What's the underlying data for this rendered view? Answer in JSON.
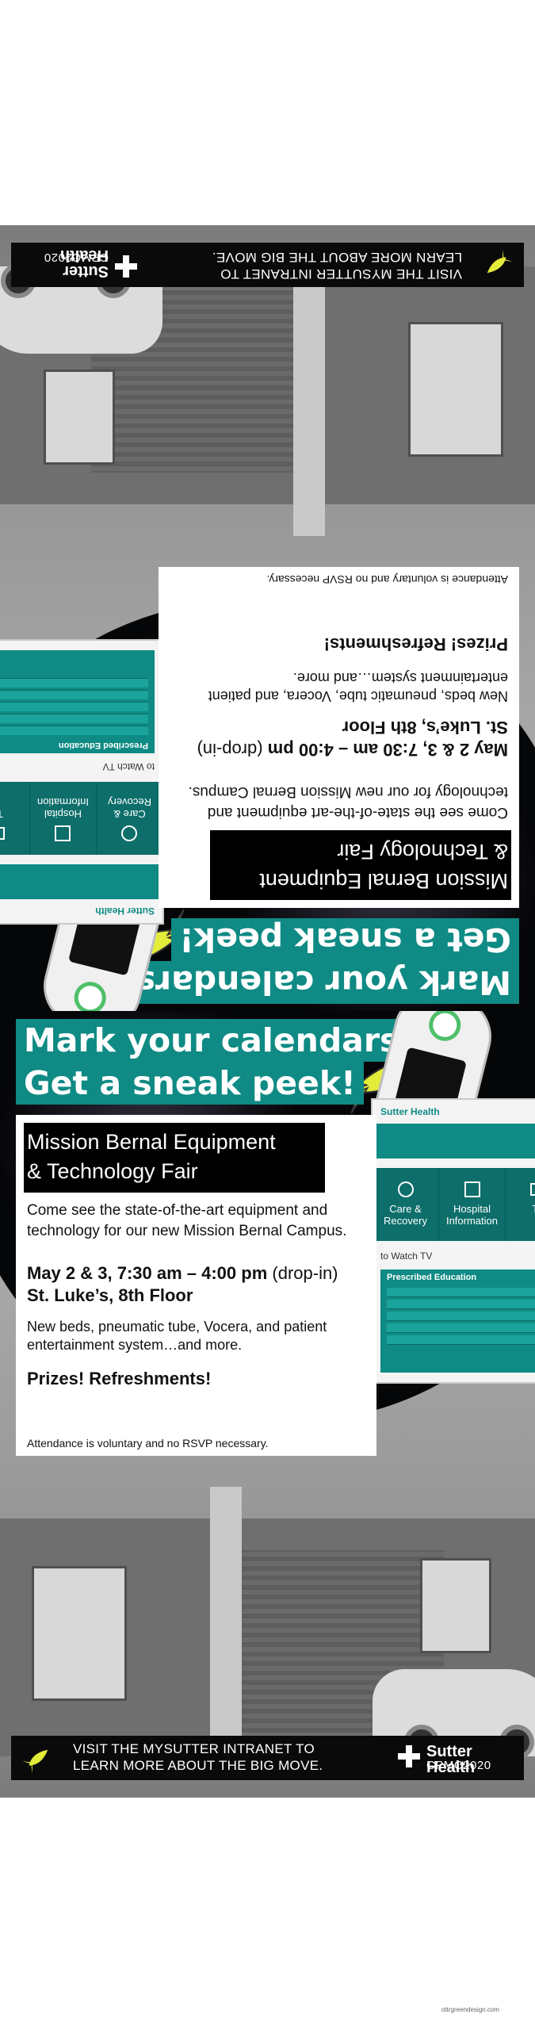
{
  "poster": {
    "headline": [
      "Mark your calendars!",
      "Get a sneak peek!"
    ],
    "event_title": [
      "Mission Bernal Equipment",
      "& Technology Fair"
    ],
    "intro": "Come see the state-of-the-art equipment and technology for our new Mission Bernal Campus.",
    "when_bold": "May 2 & 3, 7:30 am – 4:00 pm",
    "when_extra": " (drop-in)",
    "where": "St. Luke’s, 8th Floor",
    "features": "New beds, pneumatic tube, Vocera, and patient entertainment system…and more.",
    "prizes": "Prizes! Refreshments!",
    "note": "Attendance is voluntary and no RSVP necessary.",
    "visit": [
      "VISIT THE MYSUTTER INTRANET TO",
      "LEARN MORE ABOUT THE BIG MOVE."
    ],
    "logo_name": "Sutter Health",
    "logo_sub": "CPMC2020"
  },
  "tablet": {
    "brand": "Sutter Health",
    "tiles": [
      "Care & Recovery",
      "Hospital Information",
      "TV"
    ],
    "watch": "to Watch TV",
    "panel_title": "Prescribed Education"
  },
  "credit": "ottrgreendesign.com",
  "colors": {
    "teal": "#0f8a84",
    "black": "#0a0a0a",
    "rocket": "#e4ec3a"
  }
}
